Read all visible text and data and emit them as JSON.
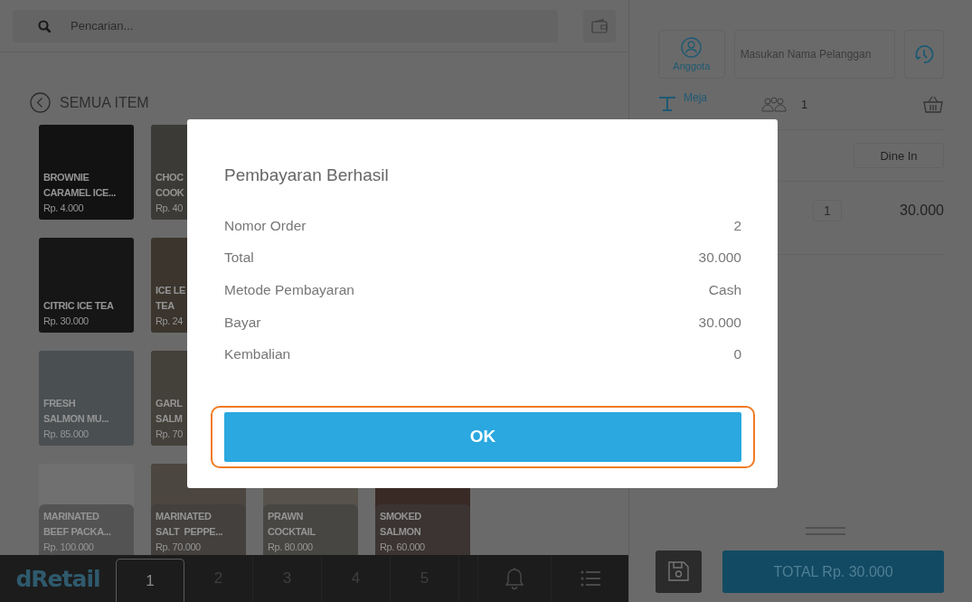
{
  "search": {
    "placeholder": "Pencarian..."
  },
  "category": {
    "title": "SEMUA ITEM"
  },
  "products": [
    {
      "name_lines": [
        "BROWNIE",
        "CARAMEL ICE..."
      ],
      "price": "Rp. 4.000",
      "has_photo": true
    },
    {
      "name_lines": [
        "CHOC",
        "COOK"
      ],
      "price": "Rp. 40",
      "has_photo": true
    },
    {
      "name_lines": [
        "CITRIC ICE TEA"
      ],
      "price": "Rp. 30.000",
      "has_photo": true
    },
    {
      "name_lines": [
        "ICE LE",
        "TEA"
      ],
      "price": "Rp. 24",
      "has_photo": true
    },
    {
      "name_lines": [
        "FRESH",
        "SALMON MU..."
      ],
      "price": "Rp. 85.000",
      "has_photo": true
    },
    {
      "name_lines": [
        "GARL",
        "SALM"
      ],
      "price": "Rp. 70",
      "has_photo": true
    },
    {
      "name_lines": [
        "MARINATED",
        "BEEF PACKA..."
      ],
      "price": "Rp. 100.000",
      "has_photo": false
    },
    {
      "name_lines": [
        "MARINATED",
        "SALT  PEPPE..."
      ],
      "price": "Rp. 70.000",
      "has_photo": true
    },
    {
      "name_lines": [
        "PRAWN",
        "COCKTAIL"
      ],
      "price": "Rp. 80.000",
      "has_photo": true
    },
    {
      "name_lines": [
        "SMOKED",
        "SALMON"
      ],
      "price": "Rp. 60.000",
      "has_photo": true
    }
  ],
  "bottom_bar": {
    "logo": "dRetail",
    "tabs": [
      {
        "label": "1",
        "selected": true
      },
      {
        "label": "2",
        "selected": false
      },
      {
        "label": "3",
        "selected": false
      },
      {
        "label": "4",
        "selected": false
      },
      {
        "label": "5",
        "selected": false
      }
    ]
  },
  "order": {
    "member_button": "Anggota",
    "customer_field": {
      "placeholder": "Masukan Nama Pelanggan"
    },
    "table_label": "Meja",
    "guests": "1",
    "order_type": "Dine In",
    "lines": [
      {
        "qty": "1",
        "amount": "30.000"
      }
    ],
    "total_button": "TOTAL Rp. 30.000"
  },
  "dialog": {
    "title": "Pembayaran Berhasil",
    "rows": [
      {
        "label": "Nomor Order",
        "value": "2"
      },
      {
        "label": "Total",
        "value": "30.000"
      },
      {
        "label": "Metode Pembayaran",
        "value": "Cash"
      },
      {
        "label": "Bayar",
        "value": "30.000"
      },
      {
        "label": "Kembalian",
        "value": "0"
      }
    ],
    "ok_button": "OK"
  }
}
